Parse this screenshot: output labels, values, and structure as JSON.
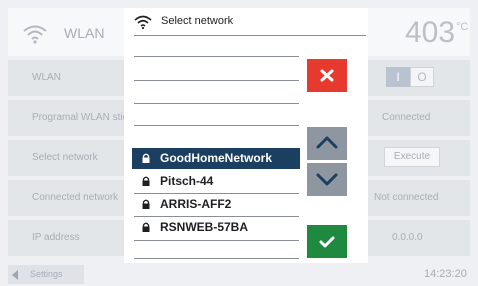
{
  "background": {
    "header": {
      "title": "WLAN",
      "temperature": "403",
      "temperature_unit": "°C",
      "wifi_icon": "wifi-icon"
    },
    "rows": [
      {
        "label": "WLAN"
      },
      {
        "label": "Programal WLAN stic",
        "value": "Connected"
      },
      {
        "label": "Select network",
        "value": "Execute"
      },
      {
        "label": "Connected network",
        "value": "Not connected"
      },
      {
        "label": "IP address",
        "value": "0.0.0.0"
      }
    ],
    "toggle": {
      "on_label": "I",
      "off_label": "O"
    },
    "footer": {
      "settings_label": "Settings",
      "time": "14:23:20"
    }
  },
  "dialog": {
    "title": "Select network",
    "networks": [
      {
        "name": "GoodHomeNetwork",
        "selected": true
      },
      {
        "name": "Pitsch-44",
        "selected": false
      },
      {
        "name": "ARRIS-AFF2",
        "selected": false
      },
      {
        "name": "RSNWEB-57BA",
        "selected": false
      }
    ],
    "buttons": {
      "cancel_icon": "close-icon",
      "up_icon": "chevron-up-icon",
      "down_icon": "chevron-down-icon",
      "confirm_icon": "checkmark-icon"
    }
  },
  "colors": {
    "selected_row": "#1b3f61",
    "cancel": "#e63a2f",
    "confirm": "#1f8a3f",
    "scroll": "#8e96a0",
    "background": "#eef0f3"
  }
}
